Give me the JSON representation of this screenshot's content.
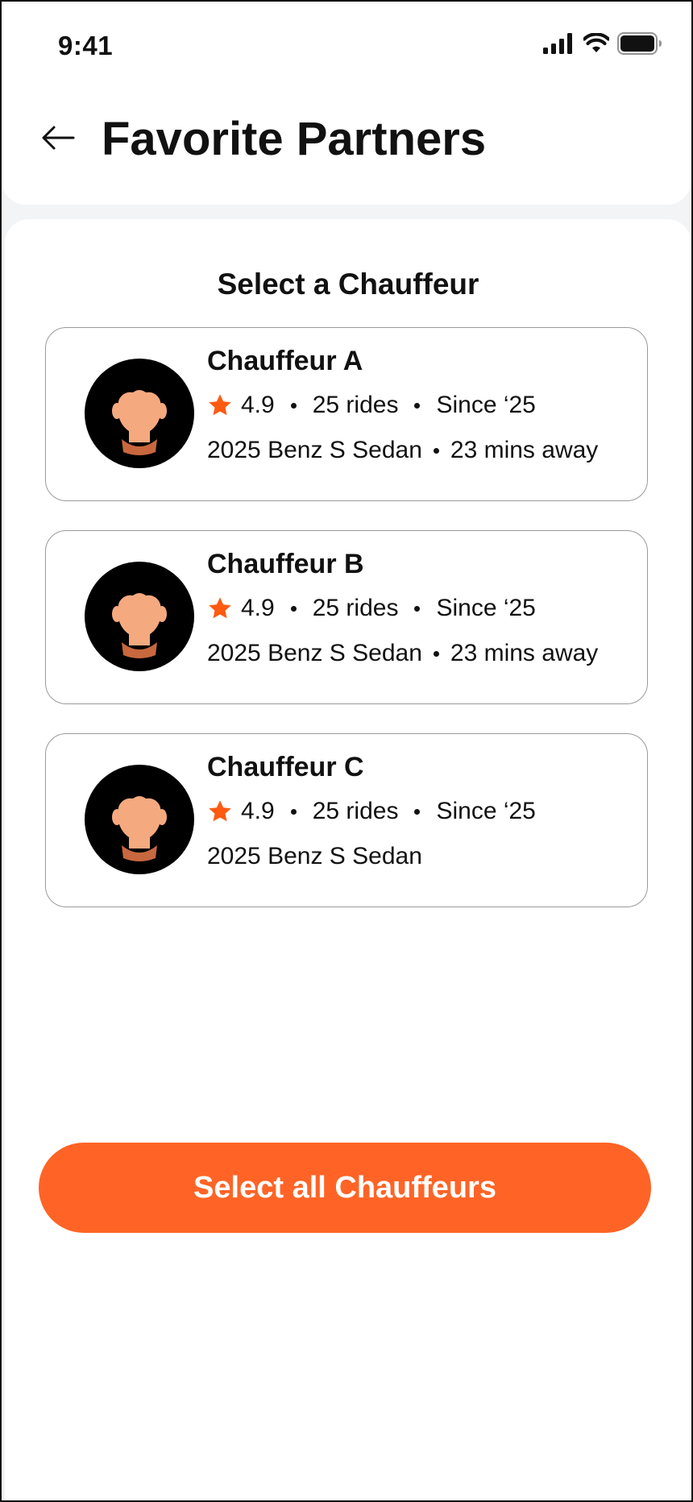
{
  "status_bar": {
    "time": "9:41",
    "icons": [
      "cellular-signal-icon",
      "wifi-icon",
      "battery-icon"
    ]
  },
  "header": {
    "back_icon": "arrow-left-icon",
    "title": "Favorite Partners"
  },
  "section": {
    "title": "Select a Chauffeur"
  },
  "chauffeurs": [
    {
      "name": "Chauffeur A",
      "rating": "4.9",
      "rides": "25 rides",
      "since": "Since ‘25",
      "car": "2025 Benz S Sedan",
      "eta": "23 mins away"
    },
    {
      "name": "Chauffeur B",
      "rating": "4.9",
      "rides": "25 rides",
      "since": "Since ‘25",
      "car": "2025 Benz S Sedan",
      "eta": "23 mins away"
    },
    {
      "name": "Chauffeur C",
      "rating": "4.9",
      "rides": "25 rides",
      "since": "Since ‘25",
      "car": "2025 Benz S Sedan",
      "eta": ""
    }
  ],
  "actions": {
    "select_all_label": "Select all Chauffeurs"
  },
  "colors": {
    "accent": "#ff6426",
    "star": "#ff5a12",
    "text": "#111111",
    "card_border": "#9a9a9a",
    "background": "#f3f4f6",
    "avatar_bg": "#000000",
    "skin": "#f5a97f",
    "collar": "#c8683e"
  }
}
